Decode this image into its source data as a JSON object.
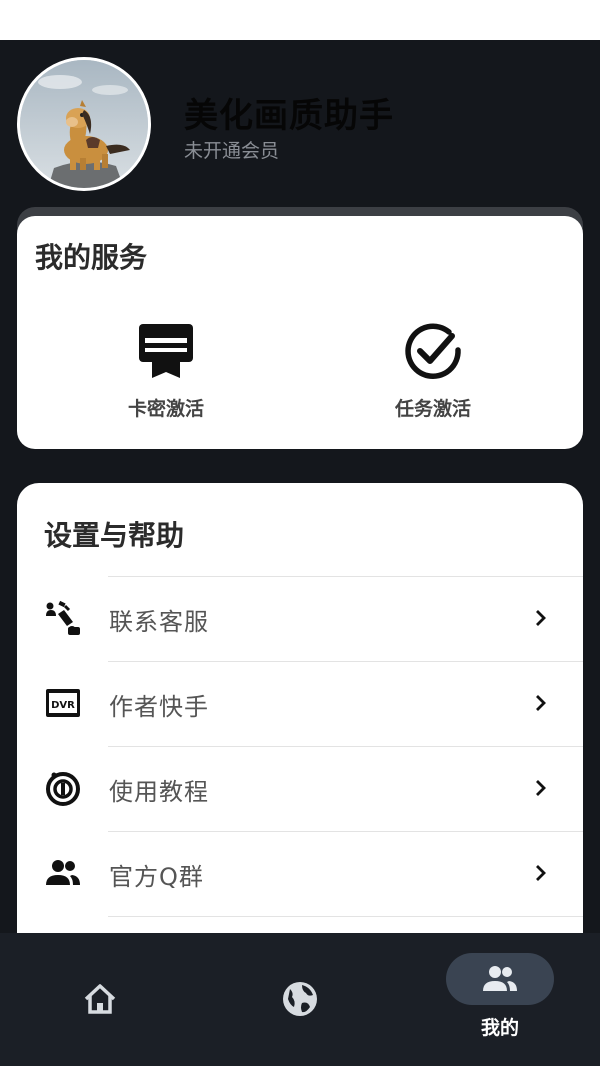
{
  "header": {
    "app_title": "美化画质助手",
    "member_status": "未开通会员"
  },
  "services": {
    "title": "我的服务",
    "items": [
      {
        "label": "卡密激活",
        "icon": "card-ribbon-icon"
      },
      {
        "label": "任务激活",
        "icon": "check-circle-icon"
      }
    ]
  },
  "settings": {
    "title": "设置与帮助",
    "items": [
      {
        "label": "联系客服",
        "icon": "contact-phone-icon"
      },
      {
        "label": "作者快手",
        "icon": "dvr-icon"
      },
      {
        "label": "使用教程",
        "icon": "tutorial-icon"
      },
      {
        "label": "官方Q群",
        "icon": "group-icon"
      }
    ]
  },
  "bottom_nav": {
    "items": [
      {
        "label": "",
        "icon": "home-icon"
      },
      {
        "label": "",
        "icon": "globe-icon"
      },
      {
        "label": "我的",
        "icon": "people-icon",
        "active": true
      }
    ]
  },
  "colors": {
    "background": "#14171c",
    "card": "#ffffff",
    "nav_background": "#1b1f26",
    "nav_active_pill": "#3a4452"
  }
}
